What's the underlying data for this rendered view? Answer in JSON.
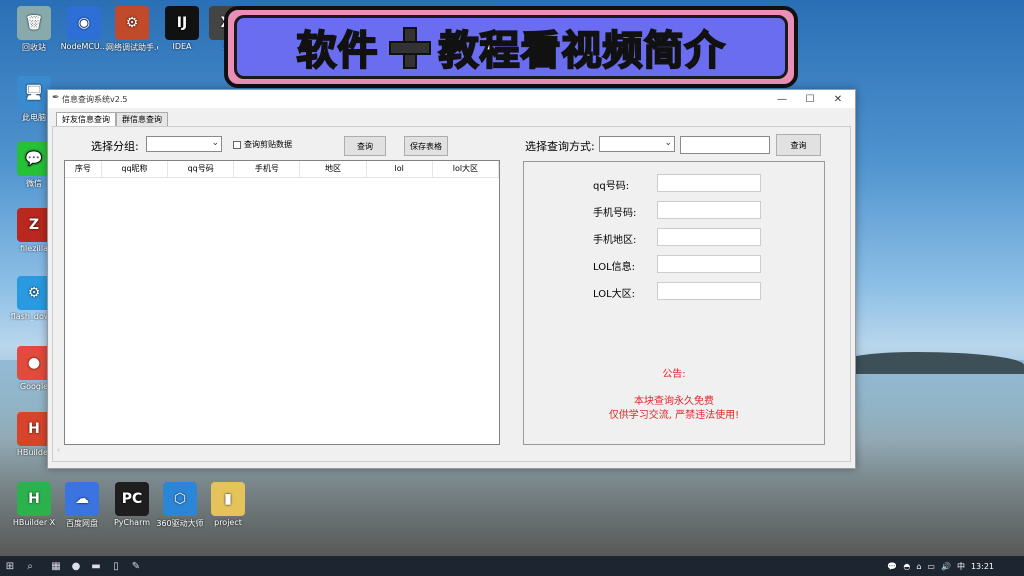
{
  "banner": {
    "text_left": "软件",
    "text_right": "教程看视频简介"
  },
  "desktop_icons": [
    {
      "label": "回收站",
      "glyph": "🗑",
      "color": "#8aa"
    },
    {
      "label": "NodeMCU...",
      "glyph": "◉",
      "color": "#2d6fd6"
    },
    {
      "label": "网络调试助手.exe",
      "glyph": "⚙",
      "color": "#c04a2a"
    },
    {
      "label": "IDEA",
      "glyph": "IJ",
      "color": "#111"
    },
    {
      "label": "X",
      "glyph": "X",
      "color": "#444"
    },
    {
      "label": "此电脑",
      "glyph": "🖥",
      "color": "#3a8ad0"
    },
    {
      "label": "微信",
      "glyph": "💬",
      "color": "#25c137"
    },
    {
      "label": "filezilla",
      "glyph": "Z",
      "color": "#b8281e"
    },
    {
      "label": "flash_dow...",
      "glyph": "⚙",
      "color": "#2a9ae0"
    },
    {
      "label": "Google",
      "glyph": "●",
      "color": "#e24a3b"
    },
    {
      "label": "HBuilder",
      "glyph": "H",
      "color": "#d8432b"
    },
    {
      "label": "HBuilder X",
      "glyph": "H",
      "color": "#2bb24c"
    },
    {
      "label": "百度网盘",
      "glyph": "☁",
      "color": "#3b73e0"
    },
    {
      "label": "PyCharm",
      "glyph": "PC",
      "color": "#1e1e1e"
    },
    {
      "label": "360驱动大师",
      "glyph": "⬡",
      "color": "#2c86d8"
    },
    {
      "label": "project",
      "glyph": "▮",
      "color": "#e5c25a"
    }
  ],
  "window": {
    "title": "信息查询系统v2.5",
    "minimize": "—",
    "maximize": "☐",
    "close": "✕",
    "tabs": [
      "好友信息查询",
      "群信息查询"
    ],
    "select_group_label": "选择分组:",
    "select_group_value": "",
    "paste_checkbox_label": "查询剪贴数据",
    "query_button": "查询",
    "save_button": "保存表格",
    "select_method_label": "选择查询方式:",
    "select_method_value": "",
    "query_input": "",
    "query_button2": "查询",
    "columns": [
      "序号",
      "qq昵称",
      "qq号码",
      "手机号",
      "地区",
      "lol",
      "lol大区"
    ],
    "fields": [
      {
        "label": "qq号码:",
        "value": ""
      },
      {
        "label": "手机号码:",
        "value": ""
      },
      {
        "label": "手机地区:",
        "value": ""
      },
      {
        "label": "LOL信息:",
        "value": ""
      },
      {
        "label": "LOL大区:",
        "value": ""
      }
    ],
    "notice_title": "公告:",
    "notice_line1": "本块查询永久免费",
    "notice_line2": "仅供学习交流, 严禁违法使用!"
  },
  "taskbar": {
    "start": "⊞",
    "search": "⌕",
    "time": "13:21",
    "ime": "中",
    "apps": [
      "▦",
      "●",
      "▬",
      "▯",
      "✎"
    ],
    "tray_icons": [
      "💬",
      "◓",
      "⌂",
      "▭",
      "🔊"
    ]
  }
}
